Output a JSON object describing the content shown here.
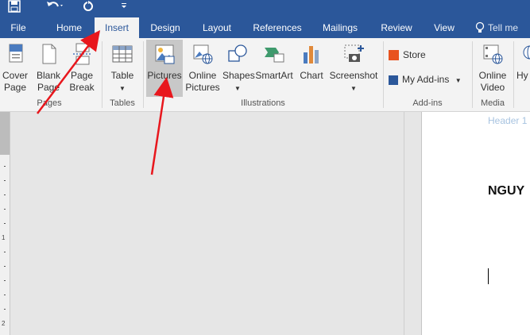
{
  "quick_access": {
    "save_icon": "save-icon",
    "undo_icon": "undo-icon",
    "redo_icon": "repeat-icon",
    "customize_icon": "customize-qat-icon"
  },
  "tabs": [
    "File",
    "Home",
    "Insert",
    "Design",
    "Layout",
    "References",
    "Mailings",
    "Review",
    "View"
  ],
  "active_tab": "Insert",
  "tell_me": "Tell me",
  "ribbon": {
    "pages_group": {
      "label": "Pages",
      "cover_page": "Cover Page",
      "blank_page": "Blank Page",
      "page_break": "Page Break"
    },
    "tables_group": {
      "label": "Tables",
      "table": "Table"
    },
    "illustrations_group": {
      "label": "Illustrations",
      "pictures": "Pictures",
      "online_pictures": "Online Pictures",
      "shapes": "Shapes",
      "smartart": "SmartArt",
      "chart": "Chart",
      "screenshot": "Screenshot"
    },
    "addins_group": {
      "label": "Add-ins",
      "store": "Store",
      "my_addins": "My Add-ins"
    },
    "media_group": {
      "label": "Media",
      "online_video": "Online Video"
    },
    "hyperlink_partial": "Hy"
  },
  "document": {
    "header_label": "Header 1",
    "title_partial": "NGUY"
  },
  "ruler_numbers": [
    "1",
    "2"
  ],
  "colors": {
    "brand": "#2b579a",
    "ribbon_bg": "#f3f3f3",
    "annotation_arrow": "#e8171d"
  }
}
